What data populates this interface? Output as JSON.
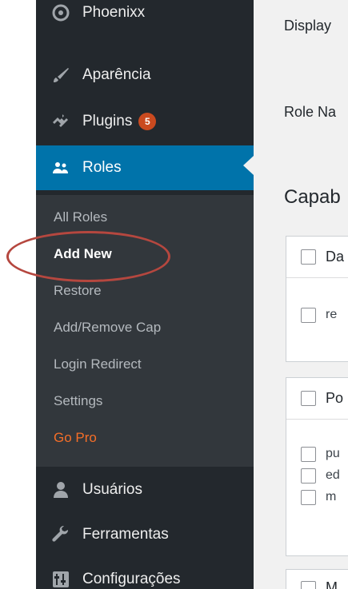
{
  "sidebar": {
    "items": [
      {
        "label": "Phoenixx",
        "icon": "theme-icon"
      },
      {
        "label": "Aparência",
        "icon": "paintbrush-icon"
      },
      {
        "label": "Plugins",
        "icon": "plugin-icon",
        "badge": "5"
      },
      {
        "label": "Roles",
        "icon": "users-icon",
        "active": true
      },
      {
        "label": "Usuários",
        "icon": "user-icon"
      },
      {
        "label": "Ferramentas",
        "icon": "wrench-icon"
      },
      {
        "label": "Configurações",
        "icon": "settings-icon"
      }
    ],
    "submenu": [
      {
        "label": "All Roles"
      },
      {
        "label": "Add New",
        "current": true
      },
      {
        "label": "Restore"
      },
      {
        "label": "Add/Remove Cap"
      },
      {
        "label": "Login Redirect"
      },
      {
        "label": "Settings"
      },
      {
        "label": "Go Pro"
      }
    ]
  },
  "main": {
    "display_label": "Display",
    "role_name_label": "Role Na",
    "capabilities_title": "Capab",
    "panels": [
      {
        "header": "Da",
        "items": [
          "re"
        ]
      },
      {
        "header": "Po",
        "items": [
          "pu",
          "ed",
          "m"
        ]
      },
      {
        "header": "M"
      }
    ]
  },
  "colors": {
    "sidebar_bg": "#23282d",
    "submenu_bg": "#32373c",
    "active_bg": "#0073aa",
    "go_pro": "#f56e28",
    "badge": "#ca4a1f",
    "highlight": "#b5473f"
  }
}
